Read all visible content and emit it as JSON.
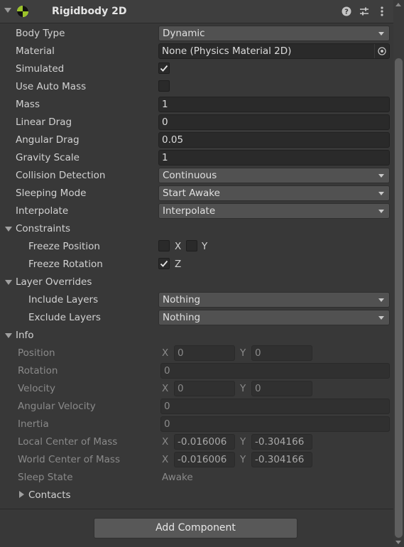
{
  "header": {
    "title": "Rigidbody 2D",
    "icons": [
      "help-icon",
      "preset-icon",
      "more-menu-icon"
    ]
  },
  "properties": {
    "body_type": {
      "label": "Body Type",
      "value": "Dynamic"
    },
    "material": {
      "label": "Material",
      "value": "None (Physics Material 2D)"
    },
    "simulated": {
      "label": "Simulated",
      "checked": true
    },
    "use_auto_mass": {
      "label": "Use Auto Mass",
      "checked": false
    },
    "mass": {
      "label": "Mass",
      "value": "1"
    },
    "linear_drag": {
      "label": "Linear Drag",
      "value": "0"
    },
    "angular_drag": {
      "label": "Angular Drag",
      "value": "0.05"
    },
    "gravity_scale": {
      "label": "Gravity Scale",
      "value": "1"
    },
    "collision_detection": {
      "label": "Collision Detection",
      "value": "Continuous"
    },
    "sleeping_mode": {
      "label": "Sleeping Mode",
      "value": "Start Awake"
    },
    "interpolate": {
      "label": "Interpolate",
      "value": "Interpolate"
    }
  },
  "constraints": {
    "label": "Constraints",
    "freeze_position": {
      "label": "Freeze Position",
      "x_label": "X",
      "y_label": "Y",
      "x": false,
      "y": false
    },
    "freeze_rotation": {
      "label": "Freeze Rotation",
      "z_label": "Z",
      "z": true
    }
  },
  "layer_overrides": {
    "label": "Layer Overrides",
    "include_layers": {
      "label": "Include Layers",
      "value": "Nothing"
    },
    "exclude_layers": {
      "label": "Exclude Layers",
      "value": "Nothing"
    }
  },
  "info": {
    "label": "Info",
    "position": {
      "label": "Position",
      "x_label": "X",
      "x": "0",
      "y_label": "Y",
      "y": "0"
    },
    "rotation": {
      "label": "Rotation",
      "value": "0"
    },
    "velocity": {
      "label": "Velocity",
      "x_label": "X",
      "x": "0",
      "y_label": "Y",
      "y": "0"
    },
    "angular_velocity": {
      "label": "Angular Velocity",
      "value": "0"
    },
    "inertia": {
      "label": "Inertia",
      "value": "0"
    },
    "local_center_of_mass": {
      "label": "Local Center of Mass",
      "x_label": "X",
      "x": "-0.016006",
      "y_label": "Y",
      "y": "-0.304166"
    },
    "world_center_of_mass": {
      "label": "World Center of Mass",
      "x_label": "X",
      "x": "-0.016006",
      "y_label": "Y",
      "y": "-0.304166"
    },
    "sleep_state": {
      "label": "Sleep State",
      "value": "Awake"
    },
    "contacts": {
      "label": "Contacts"
    }
  },
  "footer": {
    "add_component": "Add Component"
  },
  "colors": {
    "background": "#383838",
    "field": "#2a2a2a",
    "dropdown": "#515151",
    "text": "#d2d2d2",
    "dim_text": "#8a8a8a"
  }
}
